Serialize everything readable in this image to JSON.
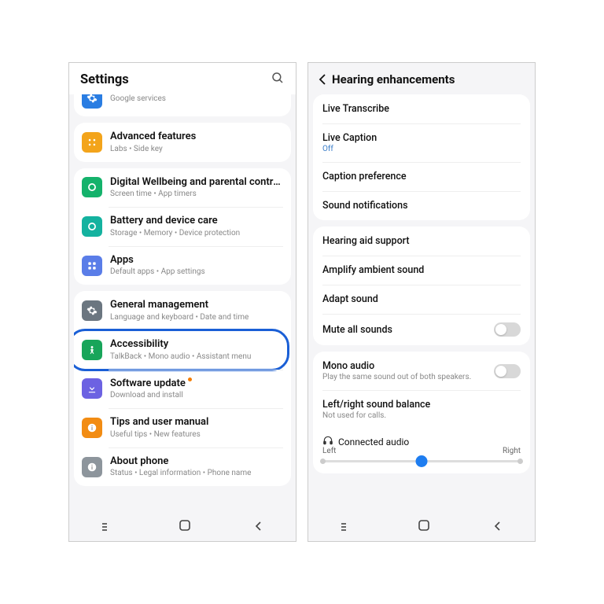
{
  "left": {
    "header_title": "Settings",
    "groups": [
      [
        {
          "icon_color": "#2a7de2",
          "icon_shape": "gear",
          "title": "",
          "sub": "Google services"
        }
      ],
      [
        {
          "icon_color": "#f3a41b",
          "icon_shape": "dots",
          "title": "Advanced features",
          "sub": "Labs  •  Side key"
        }
      ],
      [
        {
          "icon_color": "#14b26b",
          "icon_shape": "ring",
          "title": "Digital Wellbeing and parental controls",
          "sub": "Screen time  •  App timers"
        },
        {
          "icon_color": "#14b29f",
          "icon_shape": "ring",
          "title": "Battery and device care",
          "sub": "Storage  •  Memory  •  Device protection"
        },
        {
          "icon_color": "#5a7de8",
          "icon_shape": "grid",
          "title": "Apps",
          "sub": "Default apps  •  App settings"
        }
      ],
      [
        {
          "icon_color": "#6b7680",
          "icon_shape": "gear",
          "title": "General management",
          "sub": "Language and keyboard  •  Date and time"
        },
        {
          "icon_color": "#18a55a",
          "icon_shape": "person",
          "title": "Accessibility",
          "sub": "TalkBack  •  Mono audio  •  Assistant menu",
          "annotated": true
        },
        {
          "icon_color": "#6c62e2",
          "icon_shape": "down",
          "title": "Software update",
          "sub": "Download and install",
          "badge": true
        },
        {
          "icon_color": "#f28c13",
          "icon_shape": "info",
          "title": "Tips and user manual",
          "sub": "Useful tips  •  New features"
        },
        {
          "icon_color": "#8d959c",
          "icon_shape": "info",
          "title": "About phone",
          "sub": "Status  •  Legal information  •  Phone name"
        }
      ]
    ]
  },
  "right": {
    "title": "Hearing enhancements",
    "sections": [
      [
        {
          "title": "Live Transcribe"
        },
        {
          "title": "Live Caption",
          "sub": "Off",
          "sub_status": true
        },
        {
          "title": "Caption preference"
        },
        {
          "title": "Sound notifications"
        }
      ],
      [
        {
          "title": "Hearing aid support"
        },
        {
          "title": "Amplify ambient sound"
        },
        {
          "title": "Adapt sound"
        },
        {
          "title": "Mute all sounds",
          "toggle": true
        }
      ],
      [
        {
          "title": "Mono audio",
          "sub": "Play the same sound out of both speakers.",
          "toggle": true
        },
        {
          "title": "Left/right sound balance",
          "sub": "Not used for calls."
        }
      ]
    ],
    "slider": {
      "label": "Connected audio",
      "left": "Left",
      "right": "Right",
      "value_pct": 50
    }
  }
}
